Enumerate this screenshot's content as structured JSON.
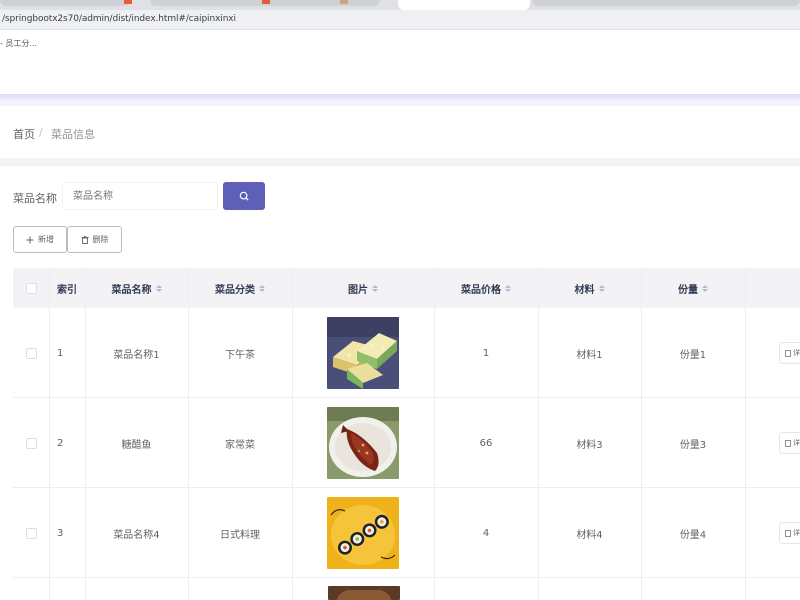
{
  "browser": {
    "url": "/springbootx2s70/admin/dist/index.html#/caipinxinxi"
  },
  "header": {
    "user_text": "- 员工分..."
  },
  "breadcrumb": {
    "home": "首页",
    "separator": "/",
    "current": "菜品信息"
  },
  "search": {
    "label": "菜品名称",
    "placeholder": "菜品名称"
  },
  "toolbar": {
    "add_label": "新增",
    "delete_label": "删除"
  },
  "table": {
    "columns": [
      "索引",
      "菜品名称",
      "菜品分类",
      "图片",
      "菜品价格",
      "材料",
      "份量"
    ],
    "rows": [
      {
        "index": "1",
        "name": "菜品名称1",
        "category": "下午茶",
        "price": "1",
        "material": "材料1",
        "portion": "份量1",
        "image": "layered-cake"
      },
      {
        "index": "2",
        "name": "糖醋鱼",
        "category": "家常菜",
        "price": "66",
        "material": "材料3",
        "portion": "份量3",
        "image": "sweet-sour-fish"
      },
      {
        "index": "3",
        "name": "菜品名称4",
        "category": "日式料理",
        "price": "4",
        "material": "材料4",
        "portion": "份量4",
        "image": "sushi-rolls"
      }
    ],
    "detail_label": "详"
  },
  "colors": {
    "accent": "#5e5fb6",
    "header_bg": "#f3f3f6",
    "border": "#ebeef5"
  }
}
